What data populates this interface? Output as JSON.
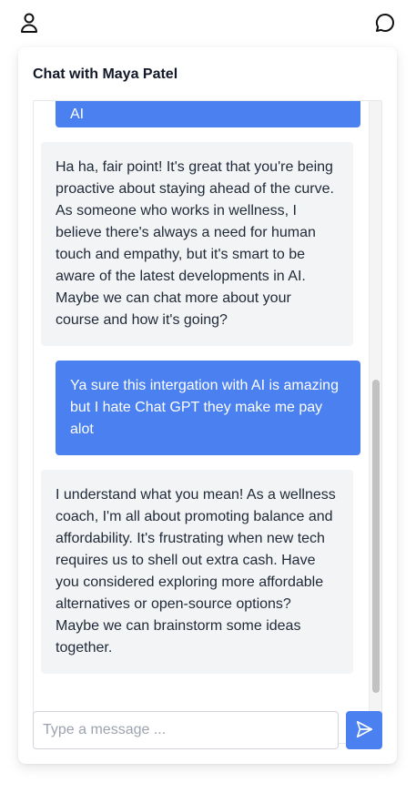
{
  "header": {
    "profile_icon": "user-icon",
    "chat_icon": "chat-bubble-icon"
  },
  "chat": {
    "title": "Chat with Maya Patel",
    "messages": [
      {
        "sender": "user",
        "text": "AI"
      },
      {
        "sender": "bot",
        "text": "Ha ha, fair point! It's great that you're being proactive about staying ahead of the curve. As someone who works in wellness, I believe there's always a need for human touch and empathy, but it's smart to be aware of the latest developments in AI. Maybe we can chat more about your course and how it's going?"
      },
      {
        "sender": "user",
        "text": "Ya sure this intergation with AI is amazing but I hate Chat GPT they make me pay alot"
      },
      {
        "sender": "bot",
        "text": "I understand what you mean! As a wellness coach, I'm all about promoting balance and affordability. It's frustrating when new tech requires us to shell out extra cash. Have you considered exploring more affordable alternatives or open-source options? Maybe we can brainstorm some ideas together."
      }
    ]
  },
  "composer": {
    "placeholder": "Type a message ...",
    "value": "",
    "send_icon": "send-icon"
  },
  "colors": {
    "user_bubble": "#4a80f0",
    "bot_bubble": "#f3f4f6",
    "accent": "#4a80f0"
  }
}
